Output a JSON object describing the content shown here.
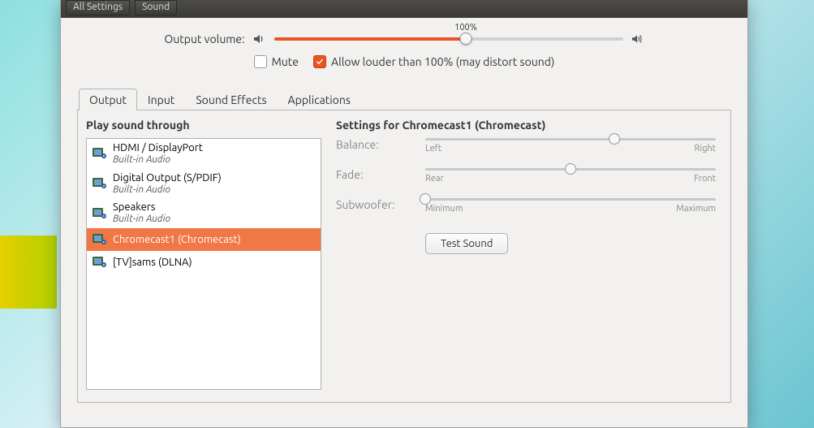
{
  "breadcrumbs": {
    "all_settings": "All Settings",
    "sound": "Sound"
  },
  "volume": {
    "label": "Output volume:",
    "tick_label": "100%",
    "percent": 55,
    "tick_percent": 55,
    "mute_label": "Mute",
    "louder_label": "Allow louder than 100% (may distort sound)",
    "mute_checked": false,
    "louder_checked": true
  },
  "tabs": [
    "Output",
    "Input",
    "Sound Effects",
    "Applications"
  ],
  "active_tab": 0,
  "left": {
    "heading": "Play sound through",
    "devices": [
      {
        "name": "HDMI / DisplayPort",
        "sub": "Built-in Audio"
      },
      {
        "name": "Digital Output (S/PDIF)",
        "sub": "Built-in Audio"
      },
      {
        "name": "Speakers",
        "sub": "Built-in Audio"
      },
      {
        "name": "Chromecast1 (Chromecast)",
        "sub": ""
      },
      {
        "name": "[TV]sams (DLNA)",
        "sub": ""
      }
    ],
    "selected": 3
  },
  "right": {
    "heading": "Settings for Chromecast1 (Chromecast)",
    "balance": {
      "label": "Balance:",
      "min": "Left",
      "max": "Right",
      "value": 65
    },
    "fade": {
      "label": "Fade:",
      "min": "Rear",
      "max": "Front",
      "value": 50
    },
    "sub": {
      "label": "Subwoofer:",
      "min": "Minimum",
      "max": "Maximum",
      "value": 0
    },
    "test_label": "Test Sound"
  }
}
